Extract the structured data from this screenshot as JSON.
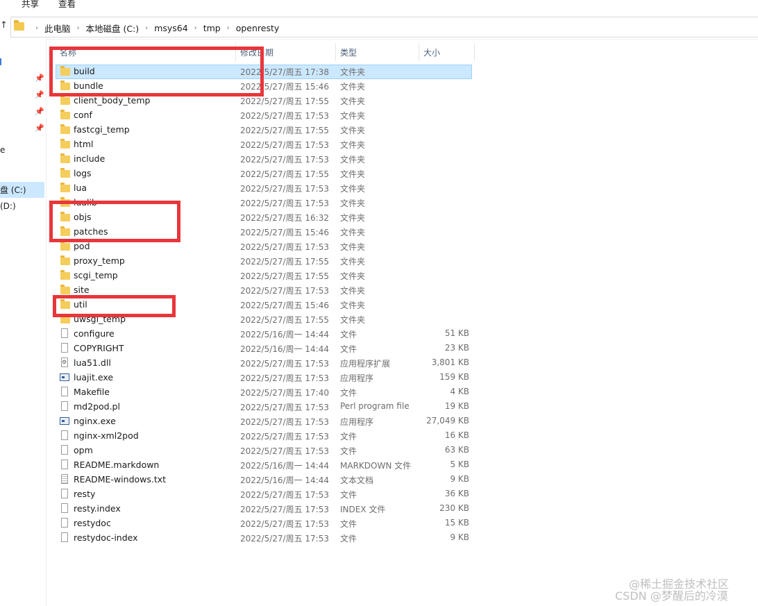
{
  "ribbon": {
    "share": "共享",
    "view": "查看"
  },
  "breadcrumb": [
    "此电脑",
    "本地磁盘 (C:)",
    "msys64",
    "tmp",
    "openresty"
  ],
  "nav": {
    "drive_c": "盘 (C:)",
    "drive_d": "(D:)",
    "partial": "e"
  },
  "columns": {
    "name": "名称",
    "date": "修改日期",
    "type": "类型",
    "size": "大小"
  },
  "files": [
    {
      "name": "build",
      "date": "2022/5/27/周五 17:38",
      "type": "文件夹",
      "size": "",
      "kind": "folder",
      "selected": true
    },
    {
      "name": "bundle",
      "date": "2022/5/27/周五 15:46",
      "type": "文件夹",
      "size": "",
      "kind": "folder"
    },
    {
      "name": "client_body_temp",
      "date": "2022/5/27/周五 17:55",
      "type": "文件夹",
      "size": "",
      "kind": "folder"
    },
    {
      "name": "conf",
      "date": "2022/5/27/周五 17:53",
      "type": "文件夹",
      "size": "",
      "kind": "folder"
    },
    {
      "name": "fastcgi_temp",
      "date": "2022/5/27/周五 17:55",
      "type": "文件夹",
      "size": "",
      "kind": "folder"
    },
    {
      "name": "html",
      "date": "2022/5/27/周五 17:53",
      "type": "文件夹",
      "size": "",
      "kind": "folder"
    },
    {
      "name": "include",
      "date": "2022/5/27/周五 17:53",
      "type": "文件夹",
      "size": "",
      "kind": "folder"
    },
    {
      "name": "logs",
      "date": "2022/5/27/周五 17:55",
      "type": "文件夹",
      "size": "",
      "kind": "folder"
    },
    {
      "name": "lua",
      "date": "2022/5/27/周五 17:53",
      "type": "文件夹",
      "size": "",
      "kind": "folder"
    },
    {
      "name": "lualib",
      "date": "2022/5/27/周五 17:53",
      "type": "文件夹",
      "size": "",
      "kind": "folder"
    },
    {
      "name": "objs",
      "date": "2022/5/27/周五 16:32",
      "type": "文件夹",
      "size": "",
      "kind": "folder"
    },
    {
      "name": "patches",
      "date": "2022/5/27/周五 15:46",
      "type": "文件夹",
      "size": "",
      "kind": "folder"
    },
    {
      "name": "pod",
      "date": "2022/5/27/周五 17:53",
      "type": "文件夹",
      "size": "",
      "kind": "folder"
    },
    {
      "name": "proxy_temp",
      "date": "2022/5/27/周五 17:55",
      "type": "文件夹",
      "size": "",
      "kind": "folder"
    },
    {
      "name": "scgi_temp",
      "date": "2022/5/27/周五 17:55",
      "type": "文件夹",
      "size": "",
      "kind": "folder"
    },
    {
      "name": "site",
      "date": "2022/5/27/周五 17:53",
      "type": "文件夹",
      "size": "",
      "kind": "folder"
    },
    {
      "name": "util",
      "date": "2022/5/27/周五 15:46",
      "type": "文件夹",
      "size": "",
      "kind": "folder"
    },
    {
      "name": "uwsgi_temp",
      "date": "2022/5/27/周五 17:55",
      "type": "文件夹",
      "size": "",
      "kind": "folder"
    },
    {
      "name": "configure",
      "date": "2022/5/16/周一 14:44",
      "type": "文件",
      "size": "51 KB",
      "kind": "file"
    },
    {
      "name": "COPYRIGHT",
      "date": "2022/5/16/周一 14:44",
      "type": "文件",
      "size": "23 KB",
      "kind": "file"
    },
    {
      "name": "lua51.dll",
      "date": "2022/5/27/周五 17:53",
      "type": "应用程序扩展",
      "size": "3,801 KB",
      "kind": "dll"
    },
    {
      "name": "luajit.exe",
      "date": "2022/5/27/周五 17:53",
      "type": "应用程序",
      "size": "159 KB",
      "kind": "exe"
    },
    {
      "name": "Makefile",
      "date": "2022/5/27/周五 17:40",
      "type": "文件",
      "size": "4 KB",
      "kind": "file"
    },
    {
      "name": "md2pod.pl",
      "date": "2022/5/27/周五 17:53",
      "type": "Perl program file",
      "size": "19 KB",
      "kind": "file"
    },
    {
      "name": "nginx.exe",
      "date": "2022/5/27/周五 17:53",
      "type": "应用程序",
      "size": "27,049 KB",
      "kind": "exe"
    },
    {
      "name": "nginx-xml2pod",
      "date": "2022/5/27/周五 17:53",
      "type": "文件",
      "size": "16 KB",
      "kind": "file"
    },
    {
      "name": "opm",
      "date": "2022/5/27/周五 17:53",
      "type": "文件",
      "size": "63 KB",
      "kind": "file"
    },
    {
      "name": "README.markdown",
      "date": "2022/5/16/周一 14:44",
      "type": "MARKDOWN 文件",
      "size": "5 KB",
      "kind": "file"
    },
    {
      "name": "README-windows.txt",
      "date": "2022/5/16/周一 14:44",
      "type": "文本文档",
      "size": "9 KB",
      "kind": "txt"
    },
    {
      "name": "resty",
      "date": "2022/5/27/周五 17:53",
      "type": "文件",
      "size": "36 KB",
      "kind": "file"
    },
    {
      "name": "resty.index",
      "date": "2022/5/27/周五 17:53",
      "type": "INDEX 文件",
      "size": "230 KB",
      "kind": "file"
    },
    {
      "name": "restydoc",
      "date": "2022/5/27/周五 17:53",
      "type": "文件",
      "size": "15 KB",
      "kind": "file"
    },
    {
      "name": "restydoc-index",
      "date": "2022/5/27/周五 17:53",
      "type": "文件",
      "size": "9 KB",
      "kind": "file"
    }
  ],
  "colors": {
    "annotation": "#e8363a",
    "selection": "#cce8ff",
    "folder": "#f5cd5c"
  },
  "watermark": {
    "line1": "@稀土掘金技术社区",
    "line2": "CSDN @梦醒后的冷漠"
  }
}
